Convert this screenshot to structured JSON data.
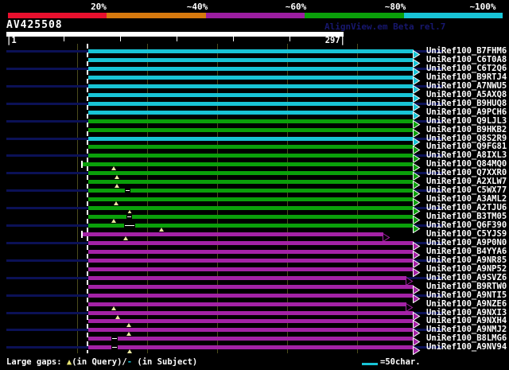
{
  "legend": {
    "labels": [
      "20%",
      "~40%",
      "~60%",
      "~80%",
      "~100%"
    ],
    "label_centers": [
      124,
      248,
      372,
      497,
      607
    ],
    "colors": [
      "#e8102e",
      "#d6790e",
      "#9c1ea1",
      "#0aa00a",
      "#18c4d6"
    ]
  },
  "query": {
    "name": "AV425508",
    "watermark": "AlignView.em Beta rel.7",
    "watermark_color": "#17176e"
  },
  "ruler": {
    "left_label": "|1",
    "right_label": "297|",
    "tick_x": [
      80,
      151,
      222,
      293,
      364
    ]
  },
  "gridlines_x": [
    97,
    185,
    273,
    361,
    449
  ],
  "colors": {
    "cyan": "#18c4d6",
    "green": "#0aa00a",
    "magenta": "#a422a6",
    "navy_guide": "#0b1156",
    "gridline": "#4b4b1d",
    "gap_triangle": "#ece9a0",
    "background": "#000000"
  },
  "footer": {
    "prefix": "Large gaps: ",
    "triangle": "▲",
    "triangle_color": "#e8e473",
    "mid": "(in Query)/",
    "dash": "-",
    "dash_color": "#18c4d6",
    "suffix": " (in Subject)",
    "scale_label": "=50char."
  },
  "rows": [
    {
      "label": "UniRef100_B7FHM6",
      "color": "cyan"
    },
    {
      "label": "UniRef100_C6T0A8",
      "color": "cyan"
    },
    {
      "label": "UniRef100_C6T2Q6",
      "color": "cyan"
    },
    {
      "label": "UniRef100_B9RTJ4",
      "color": "cyan"
    },
    {
      "label": "UniRef100_A7NWU5",
      "color": "cyan"
    },
    {
      "label": "UniRef100_A5AXQ8",
      "color": "cyan"
    },
    {
      "label": "UniRef100_B9HUQ8",
      "color": "cyan"
    },
    {
      "label": "UniRef100_A9PCH6",
      "color": "cyan"
    },
    {
      "label": "UniRef100_Q9LJL3",
      "color": "green"
    },
    {
      "label": "UniRef100_B9HKB2",
      "color": "green"
    },
    {
      "label": "UniRef100_Q8S2R9",
      "color": "cyan"
    },
    {
      "label": "UniRef100_Q9FG81",
      "color": "green"
    },
    {
      "label": "UniRef100_A8IXL3",
      "color": "green"
    },
    {
      "label": "UniRef100_Q84MQ0",
      "color": "green",
      "start": 104,
      "tick": true,
      "triangles": [
        143
      ]
    },
    {
      "label": "UniRef100_Q7XXR0",
      "color": "green",
      "triangles": [
        147
      ]
    },
    {
      "label": "UniRef100_A2XLW7",
      "color": "green",
      "triangles": [
        147
      ]
    },
    {
      "label": "UniRef100_C5WX77",
      "color": "green",
      "breaks": [
        [
          157,
          7
        ]
      ]
    },
    {
      "label": "UniRef100_A3AML2",
      "color": "green",
      "triangles": [
        146
      ]
    },
    {
      "label": "UniRef100_A2TJU6",
      "color": "green",
      "triangles": [
        163
      ]
    },
    {
      "label": "UniRef100_B3TM05",
      "color": "green",
      "triangles": [
        143
      ],
      "breaks": [
        [
          159,
          7
        ]
      ]
    },
    {
      "label": "UniRef100_Q6F390",
      "color": "green",
      "triangles": [
        203
      ],
      "breaks": [
        [
          156,
          14
        ]
      ]
    },
    {
      "label": "UniRef100_C5YJS9",
      "color": "magenta",
      "start": 104,
      "tick": true,
      "end": 482,
      "arrow": "open",
      "triangles": [
        158
      ]
    },
    {
      "label": "UniRef100_A9P0N0",
      "color": "magenta"
    },
    {
      "label": "UniRef100_B4YYA6",
      "color": "magenta"
    },
    {
      "label": "UniRef100_A9NR85",
      "color": "magenta"
    },
    {
      "label": "UniRef100_A9NP52",
      "color": "magenta"
    },
    {
      "label": "UniRef100_A9SVZ6",
      "color": "magenta",
      "end": 511,
      "arrow": "open"
    },
    {
      "label": "UniRef100_B9RTW0",
      "color": "magenta"
    },
    {
      "label": "UniRef100_A9NTI5",
      "color": "magenta"
    },
    {
      "label": "UniRef100_A9NZE6",
      "color": "magenta",
      "end": 511,
      "arrow": "open",
      "triangles": [
        143
      ]
    },
    {
      "label": "UniRef100_A9NXI3",
      "color": "magenta",
      "triangles": [
        148
      ]
    },
    {
      "label": "UniRef100_A9NXH4",
      "color": "magenta",
      "triangles": [
        162
      ]
    },
    {
      "label": "UniRef100_A9NMJ2",
      "color": "magenta",
      "triangles": [
        162
      ]
    },
    {
      "label": "UniRef100_B8LMG6",
      "color": "magenta",
      "breaks": [
        [
          140,
          8
        ]
      ]
    },
    {
      "label": "UniRef100_A9NV94",
      "color": "magenta",
      "breaks": [
        [
          140,
          8
        ]
      ],
      "triangles": [
        163
      ]
    }
  ]
}
